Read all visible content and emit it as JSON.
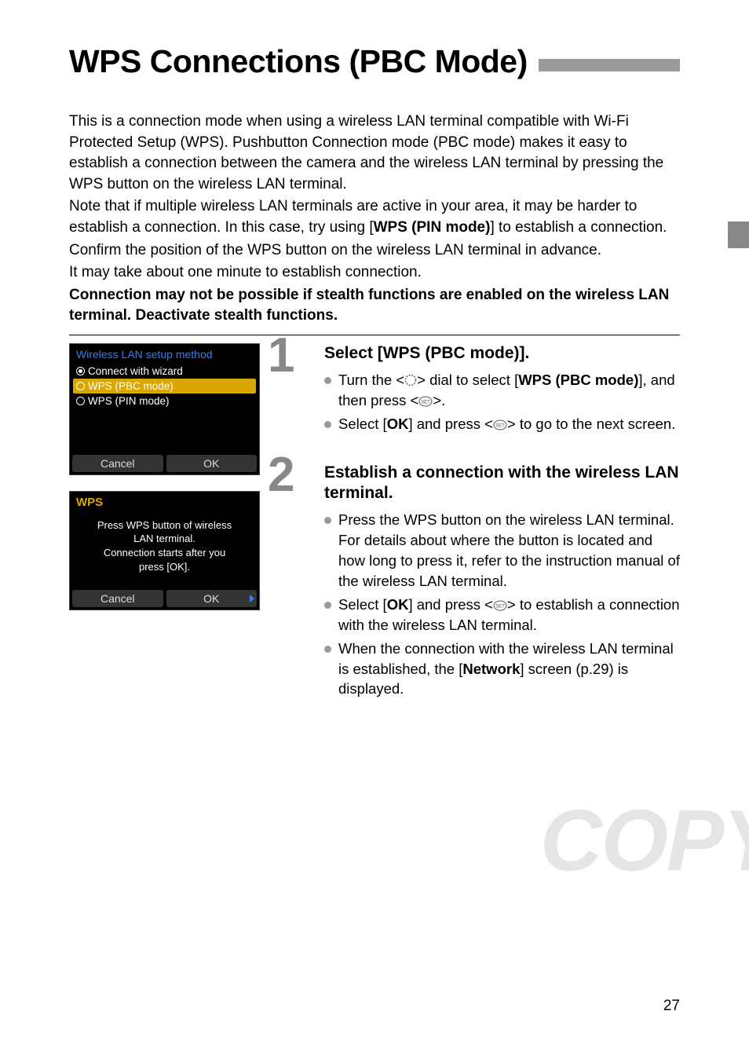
{
  "title": "WPS Connections (PBC Mode)",
  "intro": {
    "p1": "This is a connection mode when using a wireless LAN terminal compatible with Wi-Fi Protected Setup (WPS). Pushbutton Connection mode (PBC mode) makes it easy to establish a connection between the camera and the wireless LAN terminal by pressing the WPS button on the wireless LAN terminal.",
    "p2a": "Note that if multiple wireless LAN terminals are active in your area, it may be harder to establish a connection. In this case, try using [",
    "p2b": "WPS (PIN mode)",
    "p2c": "] to establish a connection.",
    "p3": "Confirm the position of the WPS button on the wireless LAN terminal in advance.",
    "p4": "It may take about one minute to establish connection.",
    "p5": "Connection may not be possible if stealth functions are enabled on the wireless LAN terminal. Deactivate stealth functions."
  },
  "screenshot1": {
    "title": "Wireless LAN setup method",
    "opt1": "Connect with wizard",
    "opt2": "WPS (PBC mode)",
    "opt3": "WPS (PIN mode)",
    "cancel": "Cancel",
    "ok": "OK"
  },
  "screenshot2": {
    "title": "WPS",
    "line1": "Press WPS button of wireless",
    "line2": "LAN terminal.",
    "line3": "Connection starts after you",
    "line4": "press [OK].",
    "cancel": "Cancel",
    "ok": "OK"
  },
  "step1": {
    "num": "1",
    "title": "Select [WPS (PBC mode)].",
    "b1a": "Turn the <",
    "b1b": "> dial to select [",
    "b1c": "WPS (PBC mode)",
    "b1d": "], and then press <",
    "b1e": ">.",
    "b2a": "Select [",
    "b2b": "OK",
    "b2c": "] and press <",
    "b2d": "> to go to the next screen."
  },
  "step2": {
    "num": "2",
    "title": "Establish a connection with the wireless LAN terminal.",
    "b1": "Press the WPS button on the wireless LAN terminal. For details about where the button is located and how long to press it, refer to the instruction manual of the wireless LAN terminal.",
    "b2a": "Select [",
    "b2b": "OK",
    "b2c": "] and press <",
    "b2d": "> to establish a connection with the wireless LAN terminal.",
    "b3a": "When the connection with the wireless LAN terminal is established, the [",
    "b3b": "Network",
    "b3c": "] screen (p.29) is displayed."
  },
  "watermark": "COPY",
  "page_number": "27"
}
